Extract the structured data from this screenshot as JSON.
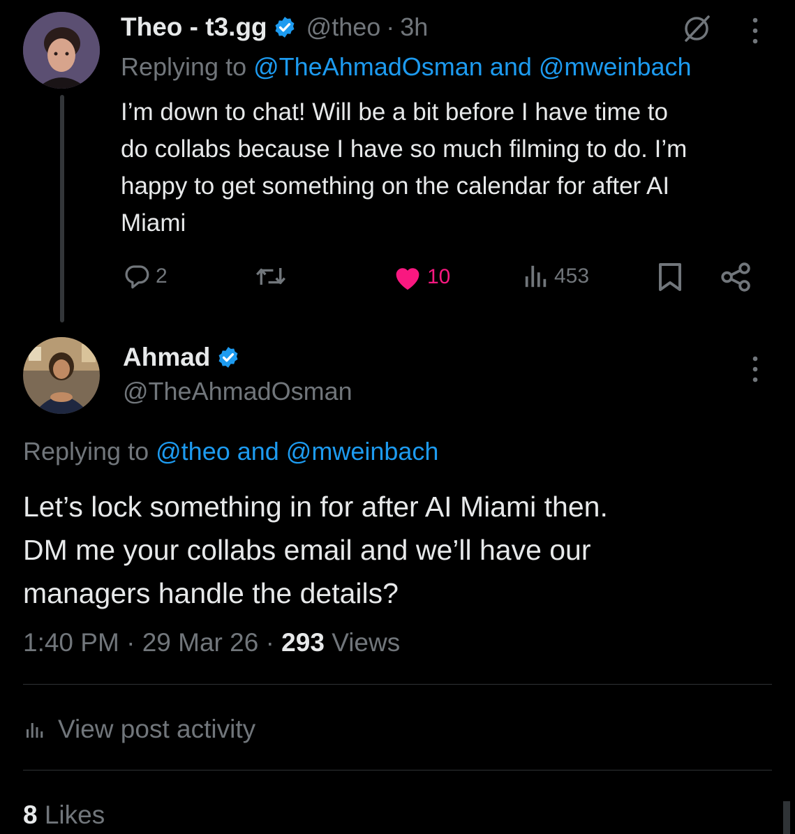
{
  "theme": {
    "background": "#000000",
    "text": "#e7e9ea",
    "muted": "#71767b",
    "link": "#1d9bf0",
    "like": "#f91880",
    "divider": "#2f3336"
  },
  "reply_tweet": {
    "display_name": "Theo - t3.gg",
    "handle": "@theo",
    "time": "3h",
    "replying_prefix": "Replying to",
    "replying_to": "@TheAhmadOsman and @mweinbach",
    "text_lines": [
      "I’m down to chat! Will be a bit before I have time to",
      "do collabs because I have so much filming to do. I’m",
      "happy to get something on the calendar for after AI",
      "Miami"
    ],
    "actions": {
      "replies": "2",
      "retweets": "",
      "likes": "10",
      "views": "453"
    },
    "icons": [
      "verified-icon",
      "grok-icon",
      "more-icon",
      "reply-icon",
      "retweet-icon",
      "heart-icon",
      "views-icon",
      "bookmark-icon",
      "share-icon"
    ]
  },
  "main_tweet": {
    "display_name": "Ahmad",
    "handle": "@TheAhmadOsman",
    "replying_prefix": "Replying to",
    "replying_to": "@theo and @mweinbach",
    "text_lines": [
      "Let’s lock something in for after AI Miami then.",
      "DM me your collabs email and we’ll have our",
      "managers handle the details?"
    ],
    "time": "1:40 PM",
    "date": "29 Mar 26",
    "views_count": "293",
    "views_label": "Views",
    "activity_label": "View post activity",
    "likes_count": "8",
    "likes_label": "Likes"
  }
}
